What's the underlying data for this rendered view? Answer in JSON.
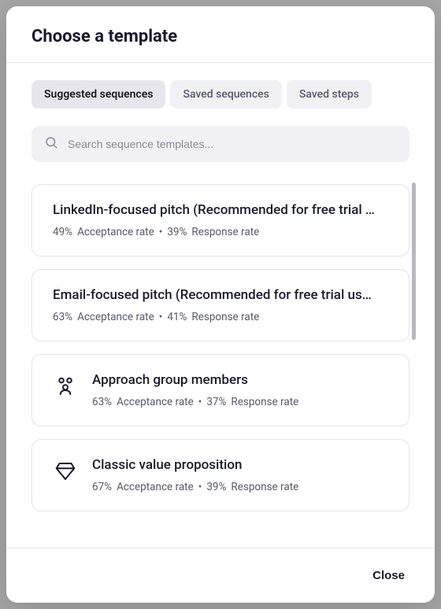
{
  "header": {
    "title": "Choose a template"
  },
  "tabs": [
    {
      "label": "Suggested sequences",
      "active": true
    },
    {
      "label": "Saved sequences",
      "active": false
    },
    {
      "label": "Saved steps",
      "active": false
    }
  ],
  "search": {
    "placeholder": "Search sequence templates..."
  },
  "templates": [
    {
      "title": "LinkedIn-focused pitch (Recommended for free trial …",
      "acceptance_pct": "49%",
      "acceptance_label": "Acceptance rate",
      "response_pct": "39%",
      "response_label": "Response rate",
      "icon": null
    },
    {
      "title": "Email-focused pitch (Recommended for free trial us…",
      "acceptance_pct": "63%",
      "acceptance_label": "Acceptance rate",
      "response_pct": "41%",
      "response_label": "Response rate",
      "icon": null
    },
    {
      "title": "Approach group members",
      "acceptance_pct": "63%",
      "acceptance_label": "Acceptance rate",
      "response_pct": "37%",
      "response_label": "Response rate",
      "icon": "group-icon"
    },
    {
      "title": "Classic value proposition",
      "acceptance_pct": "67%",
      "acceptance_label": "Acceptance rate",
      "response_pct": "39%",
      "response_label": "Response rate",
      "icon": "diamond-icon"
    }
  ],
  "footer": {
    "close_label": "Close"
  }
}
